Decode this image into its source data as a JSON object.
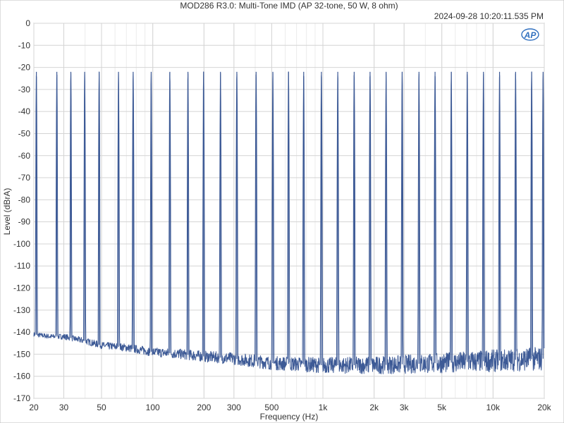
{
  "chart_data": {
    "type": "line",
    "title": "MOD286 R3.0: Multi-Tone IMD (AP 32-tone, 50 W, 8 ohm)",
    "timestamp": "2024-09-28 10:20:11.535 PM",
    "logo_text": "AP",
    "xlabel": "Frequency (Hz)",
    "ylabel": "Level (dBrA)",
    "x_scale": "log",
    "xlim": [
      20,
      20000
    ],
    "ylim": [
      -170,
      0
    ],
    "grid": true,
    "x_ticks": [
      {
        "value": 20,
        "label": "20"
      },
      {
        "value": 30,
        "label": "30"
      },
      {
        "value": 50,
        "label": "50"
      },
      {
        "value": 100,
        "label": "100"
      },
      {
        "value": 200,
        "label": "200"
      },
      {
        "value": 300,
        "label": "300"
      },
      {
        "value": 500,
        "label": "500"
      },
      {
        "value": 1000,
        "label": "1k"
      },
      {
        "value": 2000,
        "label": "2k"
      },
      {
        "value": 3000,
        "label": "3k"
      },
      {
        "value": 5000,
        "label": "5k"
      },
      {
        "value": 10000,
        "label": "10k"
      },
      {
        "value": 20000,
        "label": "20k"
      }
    ],
    "y_ticks": [
      0,
      -10,
      -20,
      -30,
      -40,
      -50,
      -60,
      -70,
      -80,
      -90,
      -100,
      -110,
      -120,
      -130,
      -140,
      -150,
      -160,
      -170
    ],
    "series": [
      {
        "color": "#3d5a96",
        "tone_level": -22,
        "tones_hz": [
          20.7,
          27.3,
          33.0,
          39.8,
          48.4,
          62.9,
          76.7,
          97.9,
          126,
          161,
          199,
          250,
          312,
          405,
          508,
          628,
          771,
          980,
          1223,
          1527,
          1893,
          2352,
          2924,
          3670,
          4562,
          5682,
          7055,
          8783,
          10920,
          13570,
          16860,
          19690
        ],
        "noise_floor": [
          {
            "x": 20,
            "y": -141
          },
          {
            "x": 25,
            "y": -142
          },
          {
            "x": 30,
            "y": -142
          },
          {
            "x": 40,
            "y": -144
          },
          {
            "x": 50,
            "y": -146
          },
          {
            "x": 70,
            "y": -147
          },
          {
            "x": 100,
            "y": -149
          },
          {
            "x": 150,
            "y": -150
          },
          {
            "x": 200,
            "y": -151
          },
          {
            "x": 300,
            "y": -152
          },
          {
            "x": 500,
            "y": -154
          },
          {
            "x": 1000,
            "y": -155
          },
          {
            "x": 2000,
            "y": -155
          },
          {
            "x": 5000,
            "y": -154
          },
          {
            "x": 10000,
            "y": -153
          },
          {
            "x": 20000,
            "y": -152
          }
        ]
      }
    ]
  }
}
